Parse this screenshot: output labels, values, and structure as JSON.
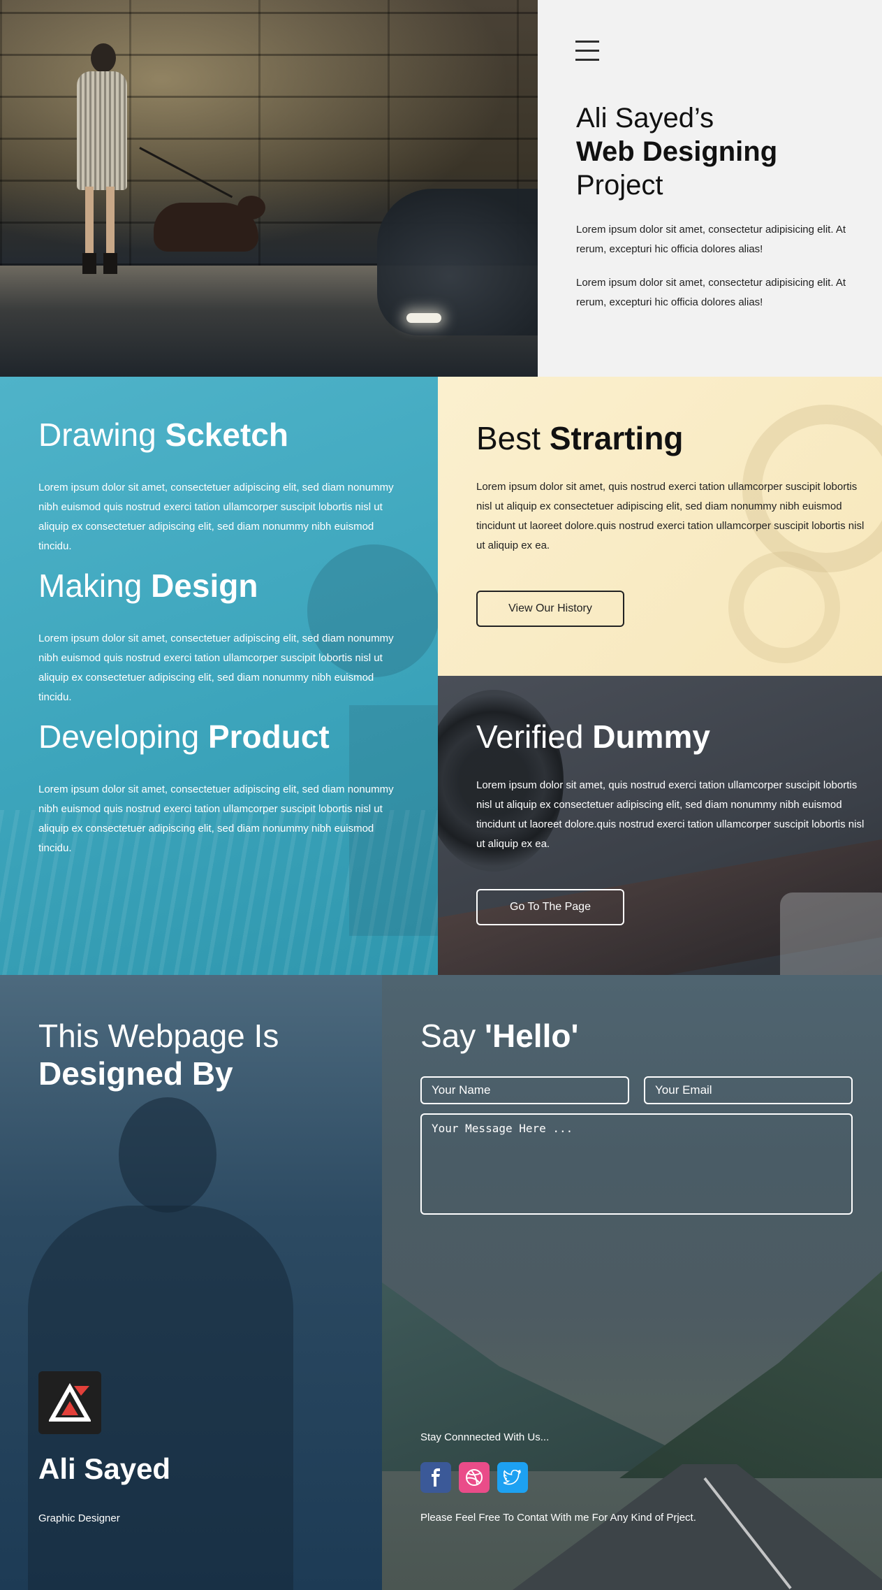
{
  "hero": {
    "title_line1": "Ali Sayed’s",
    "title_line2": "Web Designing",
    "title_line3": "Project",
    "para1": "Lorem ipsum dolor sit amet, consectetur adipisicing elit. At rerum, excepturi hic officia dolores alias!",
    "para2": "Lorem ipsum dolor sit amet, consectetur adipisicing elit. At rerum, excepturi hic officia dolores alias!",
    "menu_icon": "hamburger-icon"
  },
  "features": [
    {
      "title_light": "Drawing ",
      "title_bold": "Scketch",
      "text": "Lorem ipsum dolor sit amet, consectetuer adipiscing elit, sed diam nonummy nibh euismod quis nostrud exerci tation ullamcorper suscipit lobortis nisl ut aliquip ex consectetuer adipiscing elit, sed diam nonummy nibh euismod tincidu."
    },
    {
      "title_light": "Making ",
      "title_bold": "Design",
      "text": "Lorem ipsum dolor sit amet, consectetuer adipiscing elit, sed diam nonummy nibh euismod quis nostrud exerci tation ullamcorper suscipit lobortis nisl ut aliquip ex consectetuer adipiscing elit, sed diam nonummy nibh euismod tincidu."
    },
    {
      "title_light": "Developing ",
      "title_bold": "Product",
      "text": "Lorem ipsum dolor sit amet, consectetuer adipiscing elit, sed diam nonummy nibh euismod quis nostrud exerci tation ullamcorper suscipit lobortis nisl ut aliquip ex consectetuer adipiscing elit, sed diam nonummy nibh euismod tincidu."
    }
  ],
  "best": {
    "title_light": "Best ",
    "title_bold": "Strarting",
    "text": "Lorem ipsum dolor sit amet, quis nostrud exerci tation ullamcorper suscipit lobortis nisl ut aliquip ex consectetuer adipiscing elit, sed diam nonummy nibh euismod tincidunt ut laoreet dolore.quis nostrud exerci tation ullamcorper suscipit lobortis nisl ut aliquip ex ea.",
    "button": "View Our History"
  },
  "verified": {
    "title_light": "Verified ",
    "title_bold": "Dummy",
    "text": "Lorem ipsum dolor sit amet, quis nostrud exerci tation ullamcorper suscipit lobortis nisl ut aliquip ex consectetuer adipiscing elit, sed diam nonummy nibh euismod tincidunt ut laoreet dolore.quis nostrud exerci tation ullamcorper suscipit lobortis nisl ut aliquip ex ea.",
    "button": "Go To The Page"
  },
  "about": {
    "title_line1": "This Webpage Is",
    "title_line2": "Designed By",
    "name": "Ali Sayed",
    "role": "Graphic Designer"
  },
  "contact": {
    "title_light": "Say ",
    "title_bold": "'Hello'",
    "name_placeholder": "Your Name",
    "email_placeholder": "Your Email",
    "message_placeholder": "Your Message Here ...",
    "stay": "Stay Connnected With Us...",
    "note": "Please Feel Free To Contat With me For Any Kind of Prject.",
    "socials": [
      {
        "icon": "facebook-icon",
        "color": "#3b5998"
      },
      {
        "icon": "dribbble-icon",
        "color": "#ea4c89"
      },
      {
        "icon": "twitter-icon",
        "color": "#1da1f2"
      }
    ]
  },
  "colors": {
    "teal": "#3ea6bd",
    "cream": "#f9ebc4",
    "light_panel": "#f2f2f2",
    "logo_red": "#e3403a"
  }
}
